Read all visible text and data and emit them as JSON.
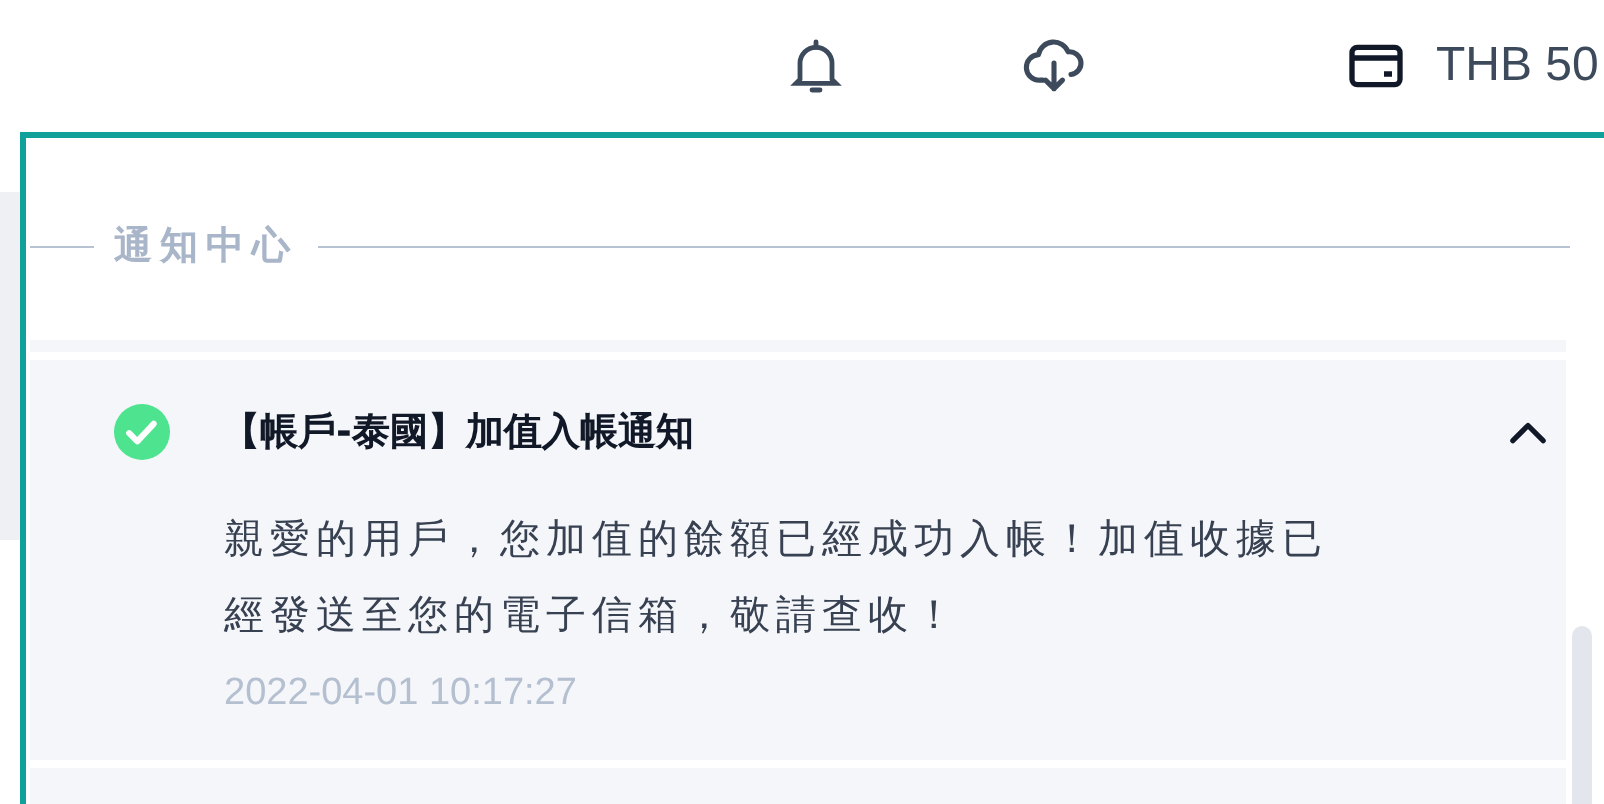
{
  "header": {
    "balance": "THB 50"
  },
  "panel": {
    "title": "通知中心",
    "notifications": [
      {
        "kind": "success",
        "title": "【帳戶-泰國】加值入帳通知",
        "expanded": true,
        "body": "親愛的用戶，您加值的餘額已經成功入帳！加值收據已經發送至您的電子信箱，敬請查收！",
        "time": "2022-04-01 10:17:27"
      }
    ]
  }
}
